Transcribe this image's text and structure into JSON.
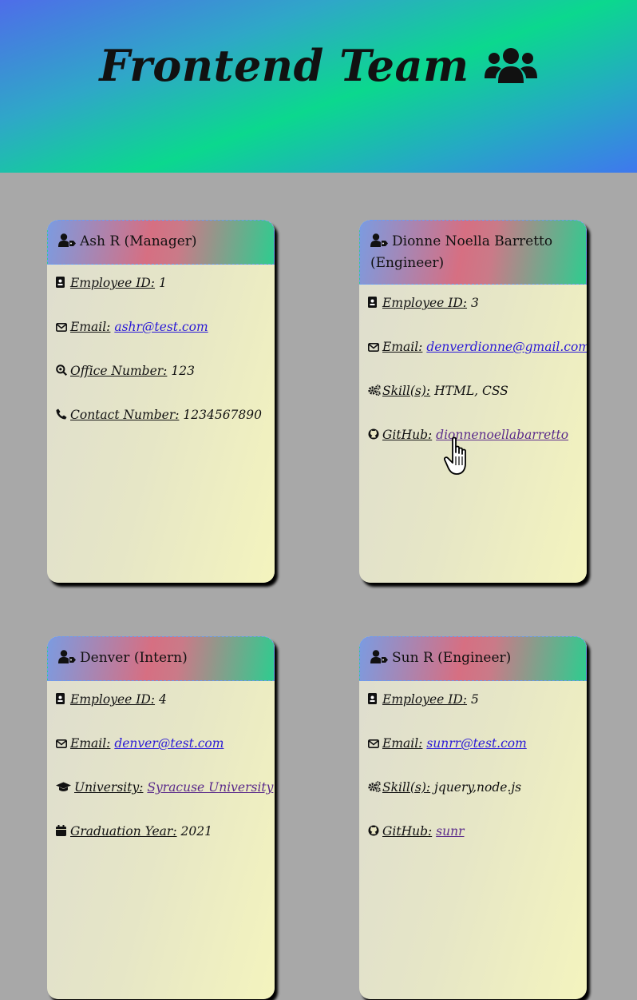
{
  "header": {
    "title": "Frontend Team",
    "icon": "users-icon"
  },
  "cards": [
    {
      "name": "Ash R (Manager)",
      "rows": [
        {
          "icon": "id-card-icon",
          "label": "Employee ID:",
          "value": "1"
        },
        {
          "icon": "envelope-icon",
          "label": "Email:",
          "link": "ashr@test.com"
        },
        {
          "icon": "search-icon",
          "label": "Office Number:",
          "value": "123"
        },
        {
          "icon": "phone-icon",
          "label": "Contact Number:",
          "value": "1234567890"
        }
      ]
    },
    {
      "name": "Dionne Noella Barretto (Engineer)",
      "rows": [
        {
          "icon": "id-card-icon",
          "label": "Employee ID:",
          "value": "3"
        },
        {
          "icon": "envelope-icon",
          "label": "Email:",
          "link": "denverdionne@gmail.com"
        },
        {
          "icon": "gears-icon",
          "label": "Skill(s):",
          "value": "HTML, CSS"
        },
        {
          "icon": "github-icon",
          "label": "GitHub:",
          "link": "dionnenoellabarretto"
        }
      ]
    },
    {
      "name": "Denver (Intern)",
      "rows": [
        {
          "icon": "id-card-icon",
          "label": "Employee ID:",
          "value": "4"
        },
        {
          "icon": "envelope-icon",
          "label": "Email:",
          "link": "denver@test.com"
        },
        {
          "icon": "graduation-cap-icon",
          "label": "University:",
          "link": "Syracuse University"
        },
        {
          "icon": "calendar-icon",
          "label": "Graduation Year:",
          "value": "2021"
        }
      ]
    },
    {
      "name": "Sun R (Engineer)",
      "rows": [
        {
          "icon": "id-card-icon",
          "label": "Employee ID:",
          "value": "5"
        },
        {
          "icon": "envelope-icon",
          "label": "Email:",
          "link": "sunrr@test.com"
        },
        {
          "icon": "gears-icon",
          "label": "Skill(s):",
          "value": "jquery,node.js"
        },
        {
          "icon": "github-icon",
          "label": "GitHub:",
          "link": "sunr"
        }
      ]
    }
  ]
}
